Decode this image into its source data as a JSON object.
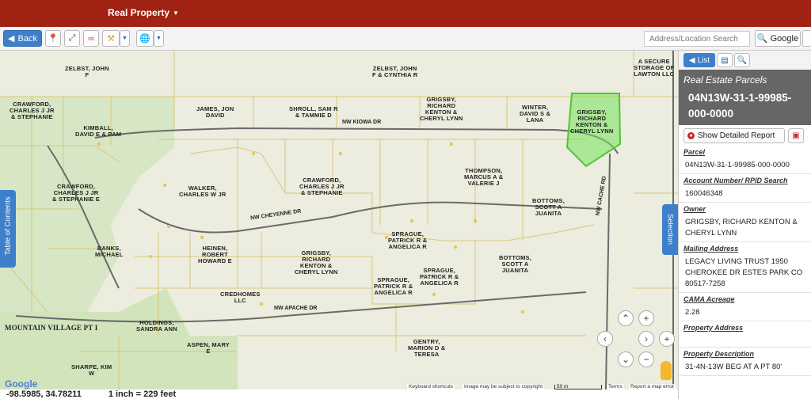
{
  "header": {
    "app_title": "Real Property"
  },
  "toolbar": {
    "back_label": "Back",
    "address_placeholder": "Address/Location Search",
    "search_provider": "Google"
  },
  "map": {
    "toc_label": "Table of Contents",
    "selection_label": "Selection",
    "selected_parcel_color": "#74e35a",
    "parcels": [
      {
        "id": "zelbst-john-1",
        "text": "ZELBST, JOHN\nF"
      },
      {
        "id": "zelbst-john-2",
        "text": "ZELBST, JOHN\nF & CYNTHIA R"
      },
      {
        "id": "a-secure",
        "text": "A SECURE\nSTORAGE OF\nLAWTON LLC"
      },
      {
        "id": "crawford-1",
        "text": "CRAWFORD,\nCHARLES J JR\n& STEPHANIE"
      },
      {
        "id": "kimball",
        "text": "KIMBALL,\nDAVID E & PAM"
      },
      {
        "id": "jamison",
        "text": "JAMES, JON\nDAVID"
      },
      {
        "id": "shroll",
        "text": "SHROLL, SAM R\n& TAMMIE D"
      },
      {
        "id": "grigsby-1",
        "text": "GRIGSBY,\nRICHARD\nKENTON &\nCHERYL LYNN"
      },
      {
        "id": "winter",
        "text": "WINTER,\nDAVID S &\nLANA"
      },
      {
        "id": "grigsby-selected",
        "text": "GRIGSBY,\nRICHARD\nKENTON &\nCHERYL LYNN"
      },
      {
        "id": "walker",
        "text": "WALKER,\nCHARLES W JR"
      },
      {
        "id": "crawford-2",
        "text": "CRAWFORD,\nCHARLES J JR\n& STEPHANIE"
      },
      {
        "id": "crawford-3",
        "text": "CRAWFORD,\nCHARLES J JR\n& STEPHANIE E"
      },
      {
        "id": "thompson",
        "text": "THOMPSON,\nMARCUS A &\nVALERIE J"
      },
      {
        "id": "bottoms-1",
        "text": "BOTTOMS,\nSCOTT A\nJUANITA"
      },
      {
        "id": "sprague-1",
        "text": "SPRAGUE,\nPATRICK R &\nANGELICA R"
      },
      {
        "id": "bottoms-2",
        "text": "BOTTOMS,\nSCOTT A\nJUANITA"
      },
      {
        "id": "banks",
        "text": "BANKS,\nMICHAEL"
      },
      {
        "id": "heinen",
        "text": "HEINEN,\nROBERT\nHOWARD E"
      },
      {
        "id": "grigsby-2",
        "text": "GRIGSBY,\nRICHARD\nKENTON &\nCHERYL LYNN"
      },
      {
        "id": "sprague-2",
        "text": "SPRAGUE,\nPATRICK R &\nANGELICA R"
      },
      {
        "id": "sprague-3",
        "text": "SPRAGUE,\nPATRICK R &\nANGELICA R"
      },
      {
        "id": "credhomes",
        "text": "CREDHOMES\nLLC"
      },
      {
        "id": "mountain-village",
        "text": "MOUNTAIN VILLAGE PT I"
      },
      {
        "id": "holdings",
        "text": "HOLDINGS,\nSANDRA ANN"
      },
      {
        "id": "aspen",
        "text": "ASPEN, MARY\nE"
      },
      {
        "id": "gentry",
        "text": "GENTRY,\nMARION D &\nTERESA"
      },
      {
        "id": "sharpe",
        "text": "SHARPE, KIM\nW"
      }
    ],
    "streets": [
      {
        "id": "nw-kiowa",
        "text": "NW KIOWA DR"
      },
      {
        "id": "nw-cheyenne",
        "text": "NW CHEYENNE DR"
      },
      {
        "id": "nw-apache",
        "text": "NW APACHE DR"
      },
      {
        "id": "nw-cache",
        "text": "NW CACHE RD"
      }
    ],
    "attribution": {
      "google": "Google",
      "shortcuts": "Keyboard shortcuts",
      "imagery": "Image may be subject to copyright",
      "scale": "50 m",
      "terms": "Terms",
      "report": "Report a map error"
    }
  },
  "status": {
    "coordinates": "-98.5985, 34.78211",
    "scale": "1 inch = 229 feet"
  },
  "panel": {
    "list_label": "List",
    "layer_title": "Real Estate Parcels",
    "parcel_id": "04N13W-31-1-99985-000-0000",
    "report_button": "Show Detailed Report",
    "fields": [
      {
        "label": "Parcel",
        "value": "04N13W-31-1-99985-000-0000"
      },
      {
        "label": "Account Number/ RPID Search",
        "value": "160046348"
      },
      {
        "label": "Owner",
        "value": "GRIGSBY, RICHARD KENTON & CHERYL LYNN"
      },
      {
        "label": "Mailing Address",
        "value": "LEGACY LIVING TRUST 1950 CHEROKEE DR ESTES PARK CO 80517-7258"
      },
      {
        "label": "CAMA Acreage",
        "value": "2.28"
      },
      {
        "label": "Property Address",
        "value": ""
      },
      {
        "label": "Property Description",
        "value": "31-4N-13W BEG AT A PT 80'"
      }
    ]
  }
}
